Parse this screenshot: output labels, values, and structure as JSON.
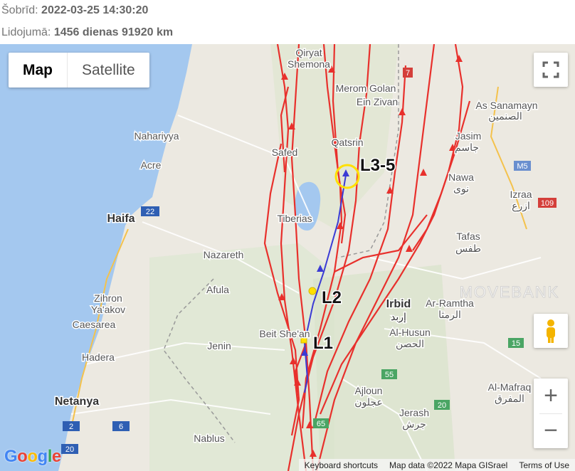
{
  "header": {
    "now_label": "Šobrīd:",
    "now_value": "2022-03-25 14:30:20",
    "flight_label": "Lidojumā:",
    "flight_value": "1456 dienas 91920 km"
  },
  "map_controls": {
    "map_label": "Map",
    "satellite_label": "Satellite",
    "fullscreen_icon": "fullscreen-icon",
    "pegman_icon": "pegman-icon",
    "zoom_in": "+",
    "zoom_out": "−"
  },
  "places": {
    "qiryat": "Qiryat",
    "shemona": "Shemona",
    "merom_golan": "Merom Golan",
    "ein_zivan": "Ein Zivan",
    "as_sanamayn": "As Sanamayn",
    "as_sanamayn_ar": "الصنمين",
    "nahariyya": "Nahariyya",
    "safed": "Safed",
    "qatsrin": "Qatsrin",
    "jasim": "Jasim",
    "jasim_ar": "جاسم",
    "acre": "Acre",
    "nawa": "Nawa",
    "nawa_ar": "نوى",
    "izraa": "Izraa",
    "izraa_ar": "ازرع",
    "haifa": "Haifa",
    "tiberias": "Tiberias",
    "nazareth": "Nazareth",
    "tafas": "Tafas",
    "tafas_ar": "طفس",
    "afula": "Afula",
    "zihron": "Zihron",
    "yaakov": "Ya'akov",
    "irbid": "Irbid",
    "irbid_ar": "إربد",
    "ar_ramtha": "Ar-Ramtha",
    "ar_ramtha_ar": "الرمثا",
    "caesarea": "Caesarea",
    "beit_shean": "Beit She'an",
    "al_husun": "Al-Husun",
    "al_husun_ar": "الحصن",
    "jenin": "Jenin",
    "hadera": "Hadera",
    "al_mafraq": "Al-Mafraq",
    "al_mafraq_ar": "المفرق",
    "ajloun": "Ajloun",
    "ajloun_ar": "عجلون",
    "netanya": "Netanya",
    "jerash": "Jerash",
    "jerash_ar": "جرش",
    "nablus": "Nablus"
  },
  "road_shields": {
    "r7": "7",
    "m5": "M5",
    "r109": "109",
    "r22": "22",
    "r15": "15",
    "r55": "55",
    "r20": "20",
    "r2": "2",
    "r6": "6",
    "r20b": "20",
    "r65": "65"
  },
  "markers": {
    "l1": "L1",
    "l2": "L2",
    "l35": "L3-5"
  },
  "watermark": "MOVEBANK",
  "attribution": {
    "shortcuts": "Keyboard shortcuts",
    "map_data": "Map data ©2022 Mapa GISrael",
    "terms": "Terms of Use"
  },
  "google_logo": "Google",
  "colors": {
    "track_red": "#e8302c",
    "track_blue": "#3b3bd4",
    "marker_yellow": "#ffe000",
    "water": "#a4c8ef"
  }
}
